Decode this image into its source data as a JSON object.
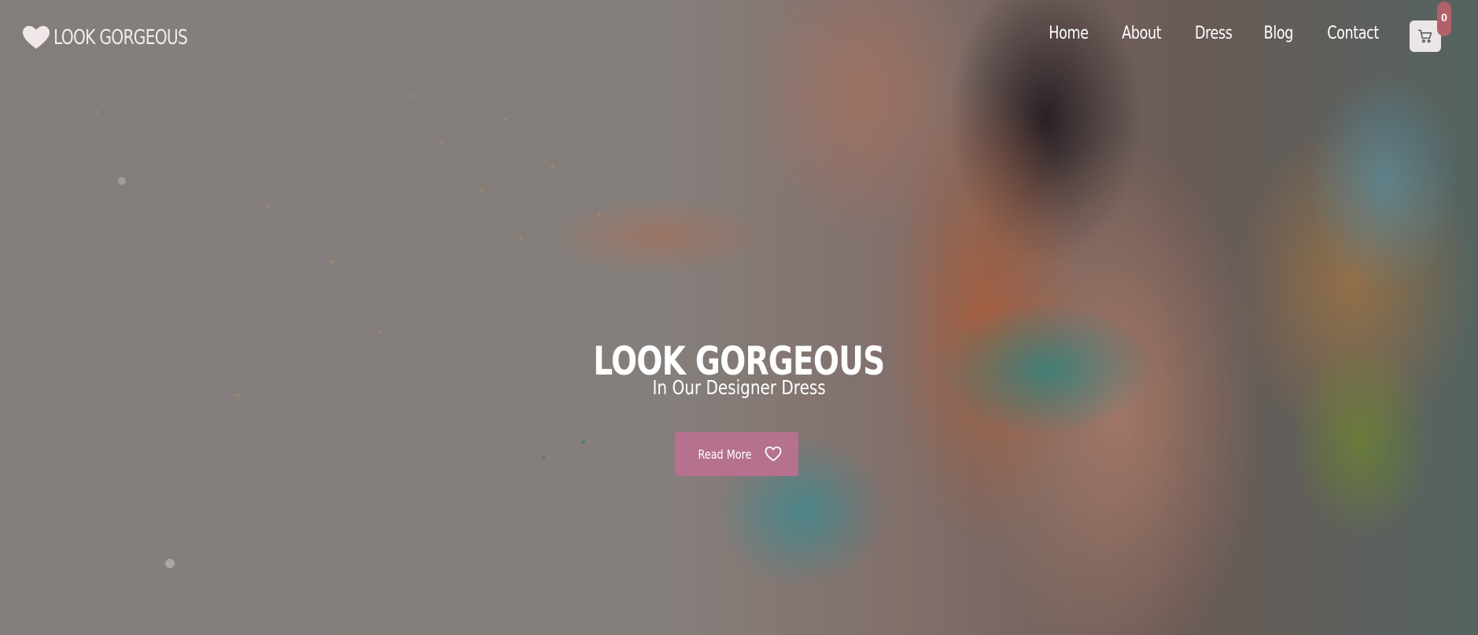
{
  "brand": {
    "name": "LOOK GORGEOUS",
    "icon": "heart-icon"
  },
  "nav": {
    "items": [
      "Home",
      "About",
      "Dress",
      "Blog",
      "Contact"
    ]
  },
  "cart": {
    "icon": "cart-icon",
    "count": "0"
  },
  "hero": {
    "title": "LOOK GORGEOUS",
    "subtitle": "In Our Designer Dress",
    "button_label": "Read More",
    "button_icon": "heart-outline-icon"
  },
  "colors": {
    "button": "#b5718e",
    "badge": "#b1616a",
    "cart_bg": "#ece6e6"
  }
}
